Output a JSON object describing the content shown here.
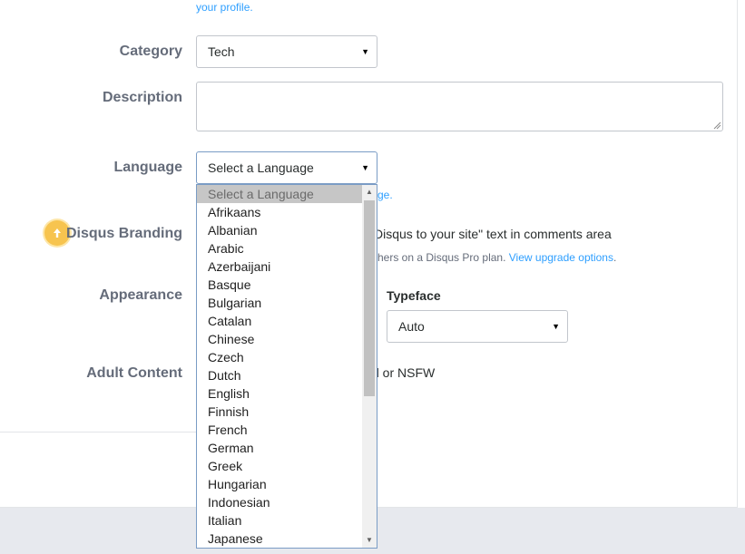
{
  "top_link": "your profile.",
  "category": {
    "label": "Category",
    "value": "Tech"
  },
  "description": {
    "label": "Description",
    "value": ""
  },
  "language": {
    "label": "Language",
    "value": "Select a Language",
    "hint_tail": "ge.",
    "options": [
      "Select a Language",
      "Afrikaans",
      "Albanian",
      "Arabic",
      "Azerbaijani",
      "Basque",
      "Bulgarian",
      "Catalan",
      "Chinese",
      "Czech",
      "Dutch",
      "English",
      "Finnish",
      "French",
      "German",
      "Greek",
      "Hungarian",
      "Indonesian",
      "Italian",
      "Japanese"
    ]
  },
  "branding": {
    "label": "Disqus Branding",
    "text_tail": "Disqus to your site\" text in comments area",
    "note_tail": "shers on a Disqus Pro plan.",
    "note_link": "View upgrade options",
    "note_end": ".",
    "icon": "arrow-up-circle-icon",
    "icon_color": "#f7c44f"
  },
  "appearance": {
    "label": "Appearance",
    "typeface_label": "Typeface",
    "typeface_value": "Auto"
  },
  "adult": {
    "label": "Adult Content",
    "text_tail": "d or NSFW"
  },
  "colors": {
    "link": "#2e9fff",
    "label": "#656c7a",
    "focus_border": "#7a9cc5",
    "footer_bg": "#e7e9ee"
  }
}
